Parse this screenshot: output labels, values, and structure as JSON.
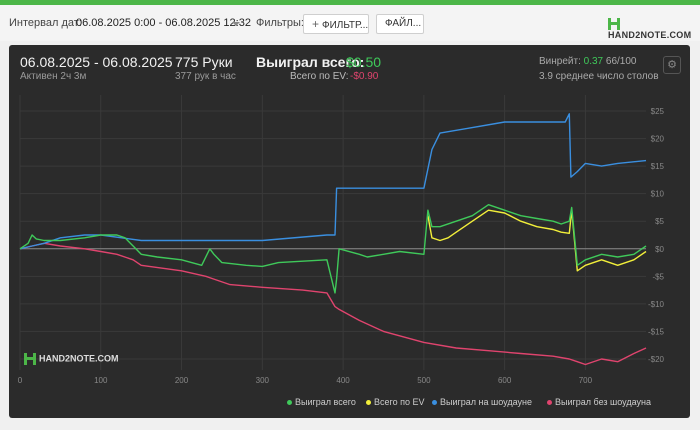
{
  "toolbar": {
    "date_label": "Интервал дат:",
    "date_value": "06.08.2025 0:00 - 06.08.2025 12:32",
    "filters_label": "Фильтры:",
    "filter_button": "ФИЛЬТР...",
    "file_button": "ФАЙЛ...",
    "logo_text": "HAND2NOTE.COM"
  },
  "stats": {
    "date_range": "06.08.2025 - 06.08.2025",
    "active": "Активен 2ч 3м",
    "hands": "775 Руки",
    "hands_per_hour": "377 рук в час",
    "won_total_label": "Выиграл всего:",
    "won_total_value": "$0.50",
    "ev_label": "Всего по EV:",
    "ev_value": "-$0.90",
    "winrate_label": "Винрейт:",
    "winrate_value": "0.37",
    "winrate_suffix": "66/100",
    "avg_tables": "3.9 среднее число столов"
  },
  "watermark": "HAND2NOTE.COM",
  "colors": {
    "won_total": "#3fc95a",
    "ev": "#f2ef3a",
    "showdown": "#3a8fe0",
    "non_showdown": "#e0446e",
    "accent": "#4cb648"
  },
  "chart_data": {
    "type": "line",
    "xlabel": "",
    "ylabel": "",
    "xlim": [
      0,
      775
    ],
    "ylim": [
      -22,
      27
    ],
    "x_ticks": [
      0,
      100,
      200,
      300,
      400,
      500,
      600,
      700
    ],
    "y_ticks": [
      25,
      20,
      15,
      10,
      5,
      0,
      -5,
      -10,
      -15,
      -20
    ],
    "y_tick_labels": [
      "$25",
      "$20",
      "$15",
      "$10",
      "$5",
      "$0",
      "-$5",
      "-$10",
      "-$15",
      "-$20"
    ],
    "legend_position": "bottom-right",
    "grid": true,
    "series": [
      {
        "name": "Выиграл всего",
        "color": "#3fc95a",
        "x": [
          0,
          10,
          15,
          20,
          30,
          50,
          80,
          100,
          120,
          130,
          140,
          150,
          170,
          200,
          225,
          235,
          240,
          250,
          280,
          300,
          320,
          380,
          390,
          392,
          395,
          420,
          430,
          450,
          470,
          500,
          505,
          510,
          520,
          540,
          560,
          580,
          600,
          620,
          640,
          660,
          670,
          680,
          683,
          690,
          700,
          720,
          740,
          760,
          775
        ],
        "values": [
          0,
          1,
          2.5,
          1.8,
          1.5,
          1.5,
          2,
          2.5,
          2.5,
          2,
          0.5,
          -1,
          -1.5,
          -2,
          -3,
          0,
          -1,
          -2.5,
          -3,
          -3.2,
          -2.5,
          -2,
          -8,
          -5.5,
          0,
          -1,
          -1.5,
          -1,
          -0.5,
          -1,
          7,
          4,
          4,
          5,
          6,
          8,
          7,
          6,
          5.5,
          5,
          4.5,
          5,
          7.5,
          -3,
          -2,
          -1,
          -1.5,
          -1,
          0.5
        ]
      },
      {
        "name": "Всего по EV",
        "color": "#f2ef3a",
        "x": [
          505,
          510,
          520,
          530,
          540,
          560,
          580,
          600,
          620,
          640,
          660,
          670,
          680,
          683,
          690,
          700,
          720,
          740,
          760,
          775
        ],
        "values": [
          6,
          2,
          1.5,
          2,
          3,
          5,
          7,
          6.5,
          5,
          4,
          3.5,
          3,
          2.8,
          7,
          -4,
          -3,
          -2,
          -3,
          -2,
          -0.5
        ]
      },
      {
        "name": "Выиграл на шоудауне",
        "color": "#3a8fe0",
        "x": [
          0,
          15,
          30,
          50,
          80,
          100,
          150,
          200,
          250,
          300,
          380,
          390,
          392,
          430,
          500,
          510,
          520,
          560,
          600,
          640,
          675,
          680,
          682,
          690,
          700,
          720,
          740,
          775
        ],
        "values": [
          0,
          0.5,
          1,
          2,
          2.5,
          2.5,
          1.5,
          1.5,
          1.5,
          1.5,
          2.5,
          2.5,
          11,
          11,
          11,
          18,
          21,
          22,
          23,
          23,
          23,
          24.5,
          13,
          14,
          15.5,
          15,
          15.5,
          16
        ]
      },
      {
        "name": "Выиграл без шоудауна",
        "color": "#e0446e",
        "x": [
          0,
          15,
          30,
          50,
          80,
          100,
          120,
          140,
          150,
          200,
          230,
          240,
          260,
          300,
          350,
          380,
          390,
          395,
          420,
          450,
          500,
          540,
          580,
          620,
          660,
          680,
          690,
          700,
          720,
          740,
          760,
          775
        ],
        "values": [
          0,
          0.5,
          1,
          0.5,
          0,
          -0.5,
          -1,
          -2,
          -3,
          -4,
          -5,
          -5.5,
          -6.5,
          -7,
          -7.5,
          -8,
          -10.5,
          -11,
          -13,
          -15,
          -17,
          -18,
          -18.5,
          -19,
          -19.5,
          -20,
          -20.5,
          -21,
          -20,
          -20.5,
          -19,
          -18
        ]
      }
    ]
  }
}
